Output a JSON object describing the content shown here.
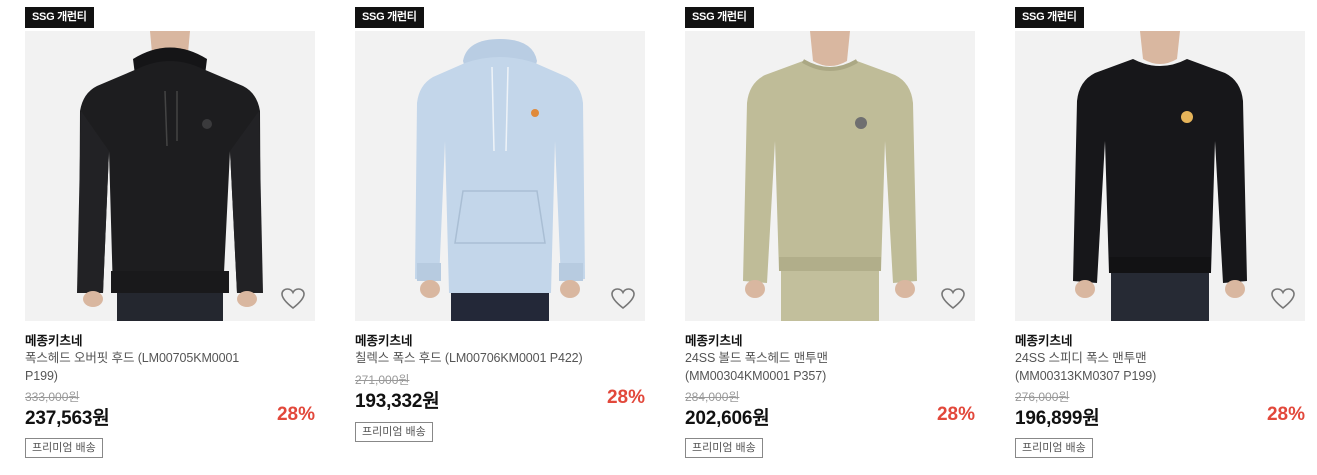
{
  "products": [
    {
      "badge": "SSG 개런티",
      "brand": "메종키츠네",
      "name": "폭스헤드 오버핏 후드 (LM00705KM0001 P199)",
      "original_price": "333,000원",
      "price": "237,563원",
      "discount": "28%",
      "shipping": "프리미엄 배송",
      "image": {
        "garment": "hoodie",
        "color": "#1d1d1f",
        "logo": "grey-fox-head"
      },
      "wishlist_icon": "heart-outline-icon"
    },
    {
      "badge": "SSG 개런티",
      "brand": "메종키츠네",
      "name": "칠렉스 폭스 후드 (LM00706KM0001 P422)",
      "original_price": "271,000원",
      "price": "193,332원",
      "discount": "28%",
      "shipping": "프리미엄 배송",
      "image": {
        "garment": "hoodie",
        "color": "#c3d6ea",
        "logo": "orange-chillax-fox"
      },
      "wishlist_icon": "heart-outline-icon"
    },
    {
      "badge": "SSG 개런티",
      "brand": "메종키츠네",
      "name": "24SS 볼드 폭스헤드 맨투맨 (MM00304KM0001 P357)",
      "original_price": "284,000원",
      "price": "202,606원",
      "discount": "28%",
      "shipping": "프리미엄 배송",
      "image": {
        "garment": "sweatshirt",
        "color": "#bfbc98",
        "logo": "grey-fox-head"
      },
      "wishlist_icon": "heart-outline-icon"
    },
    {
      "badge": "SSG 개런티",
      "brand": "메종키츠네",
      "name": "24SS 스피디 폭스 맨투맨 (MM00313KM0307 P199)",
      "original_price": "276,000원",
      "price": "196,899원",
      "discount": "28%",
      "shipping": "프리미엄 배송",
      "image": {
        "garment": "sweatshirt",
        "color": "#17171a",
        "logo": "speedy-fox"
      },
      "wishlist_icon": "heart-outline-icon"
    }
  ],
  "colors": {
    "badge_bg": "#111111",
    "discount": "#e2483b",
    "photo_bg": "#f2f2f2"
  }
}
